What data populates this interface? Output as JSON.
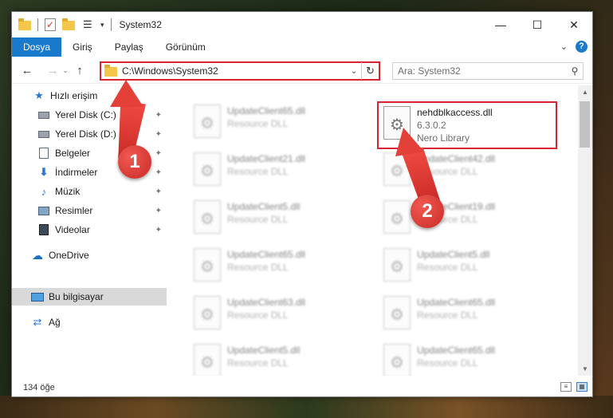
{
  "window": {
    "title": "System32",
    "qat_drop": "▾"
  },
  "titlebar": {
    "minimize": "—",
    "maximize": "☐",
    "close": "✕"
  },
  "ribbon": {
    "tabs": [
      {
        "label": "Dosya",
        "active": true
      },
      {
        "label": "Giriş"
      },
      {
        "label": "Paylaş"
      },
      {
        "label": "Görünüm"
      }
    ],
    "expand": "⌄",
    "help": "?"
  },
  "nav": {
    "back": "←",
    "forward": "→",
    "up": "↑",
    "recent": "⌄"
  },
  "address": {
    "path": "C:\\Windows\\System32",
    "dropdown": "⌄",
    "refresh": "↻"
  },
  "search": {
    "placeholder": "Ara: System32",
    "icon": "⚲"
  },
  "sidebar": {
    "items": [
      {
        "label": "Hızlı erişim",
        "icon": "star-icon"
      },
      {
        "label": "Yerel Disk (C:)",
        "icon": "drive-icon",
        "pinned": true
      },
      {
        "label": "Yerel Disk (D:)",
        "icon": "drive-icon",
        "pinned": true
      },
      {
        "label": "Belgeler",
        "icon": "documents-icon",
        "pinned": true
      },
      {
        "label": "İndirmeler",
        "icon": "downloads-icon",
        "pinned": true
      },
      {
        "label": "Müzik",
        "icon": "music-icon",
        "pinned": true
      },
      {
        "label": "Resimler",
        "icon": "pictures-icon",
        "pinned": true
      },
      {
        "label": "Videolar",
        "icon": "videos-icon",
        "pinned": true
      },
      {
        "label": "OneDrive",
        "icon": "onedrive-icon"
      },
      {
        "label": "Bu bilgisayar",
        "icon": "this-pc-icon",
        "selected": true
      },
      {
        "label": "Ağ",
        "icon": "network-icon"
      }
    ],
    "pin_glyph": "📌"
  },
  "files": {
    "highlighted": {
      "name": "nehdblkaccess.dll",
      "version": "6.3.0.2",
      "description": "Nero Library"
    },
    "left_column": [
      {
        "name": "UpdateClient65.dll",
        "type": "Resource DLL"
      },
      {
        "name": "UpdateClient21.dll",
        "type": "Resource DLL"
      },
      {
        "name": "UpdateClient5.dll",
        "type": "Resource DLL"
      },
      {
        "name": "UpdateClient65.dll",
        "type": "Resource DLL"
      },
      {
        "name": "UpdateClient63.dll",
        "type": "Resource DLL"
      },
      {
        "name": "UpdateClient5.dll",
        "type": "Resource DLL"
      }
    ],
    "right_column": [
      {
        "name": "UpdateClient42.dll",
        "type": "Resource DLL"
      },
      {
        "name": "UpdateClient19.dll",
        "type": "Resource DLL"
      },
      {
        "name": "UpdateClient5.dll",
        "type": "Resource DLL"
      },
      {
        "name": "UpdateClient65.dll",
        "type": "Resource DLL"
      },
      {
        "name": "UpdateClient65.dll",
        "type": "Resource DLL"
      }
    ]
  },
  "status": {
    "count": "134 öğe"
  },
  "annotations": {
    "step1": "1",
    "step2": "2"
  },
  "colors": {
    "accent": "#1979ca",
    "annotation_red": "#d9232e"
  }
}
